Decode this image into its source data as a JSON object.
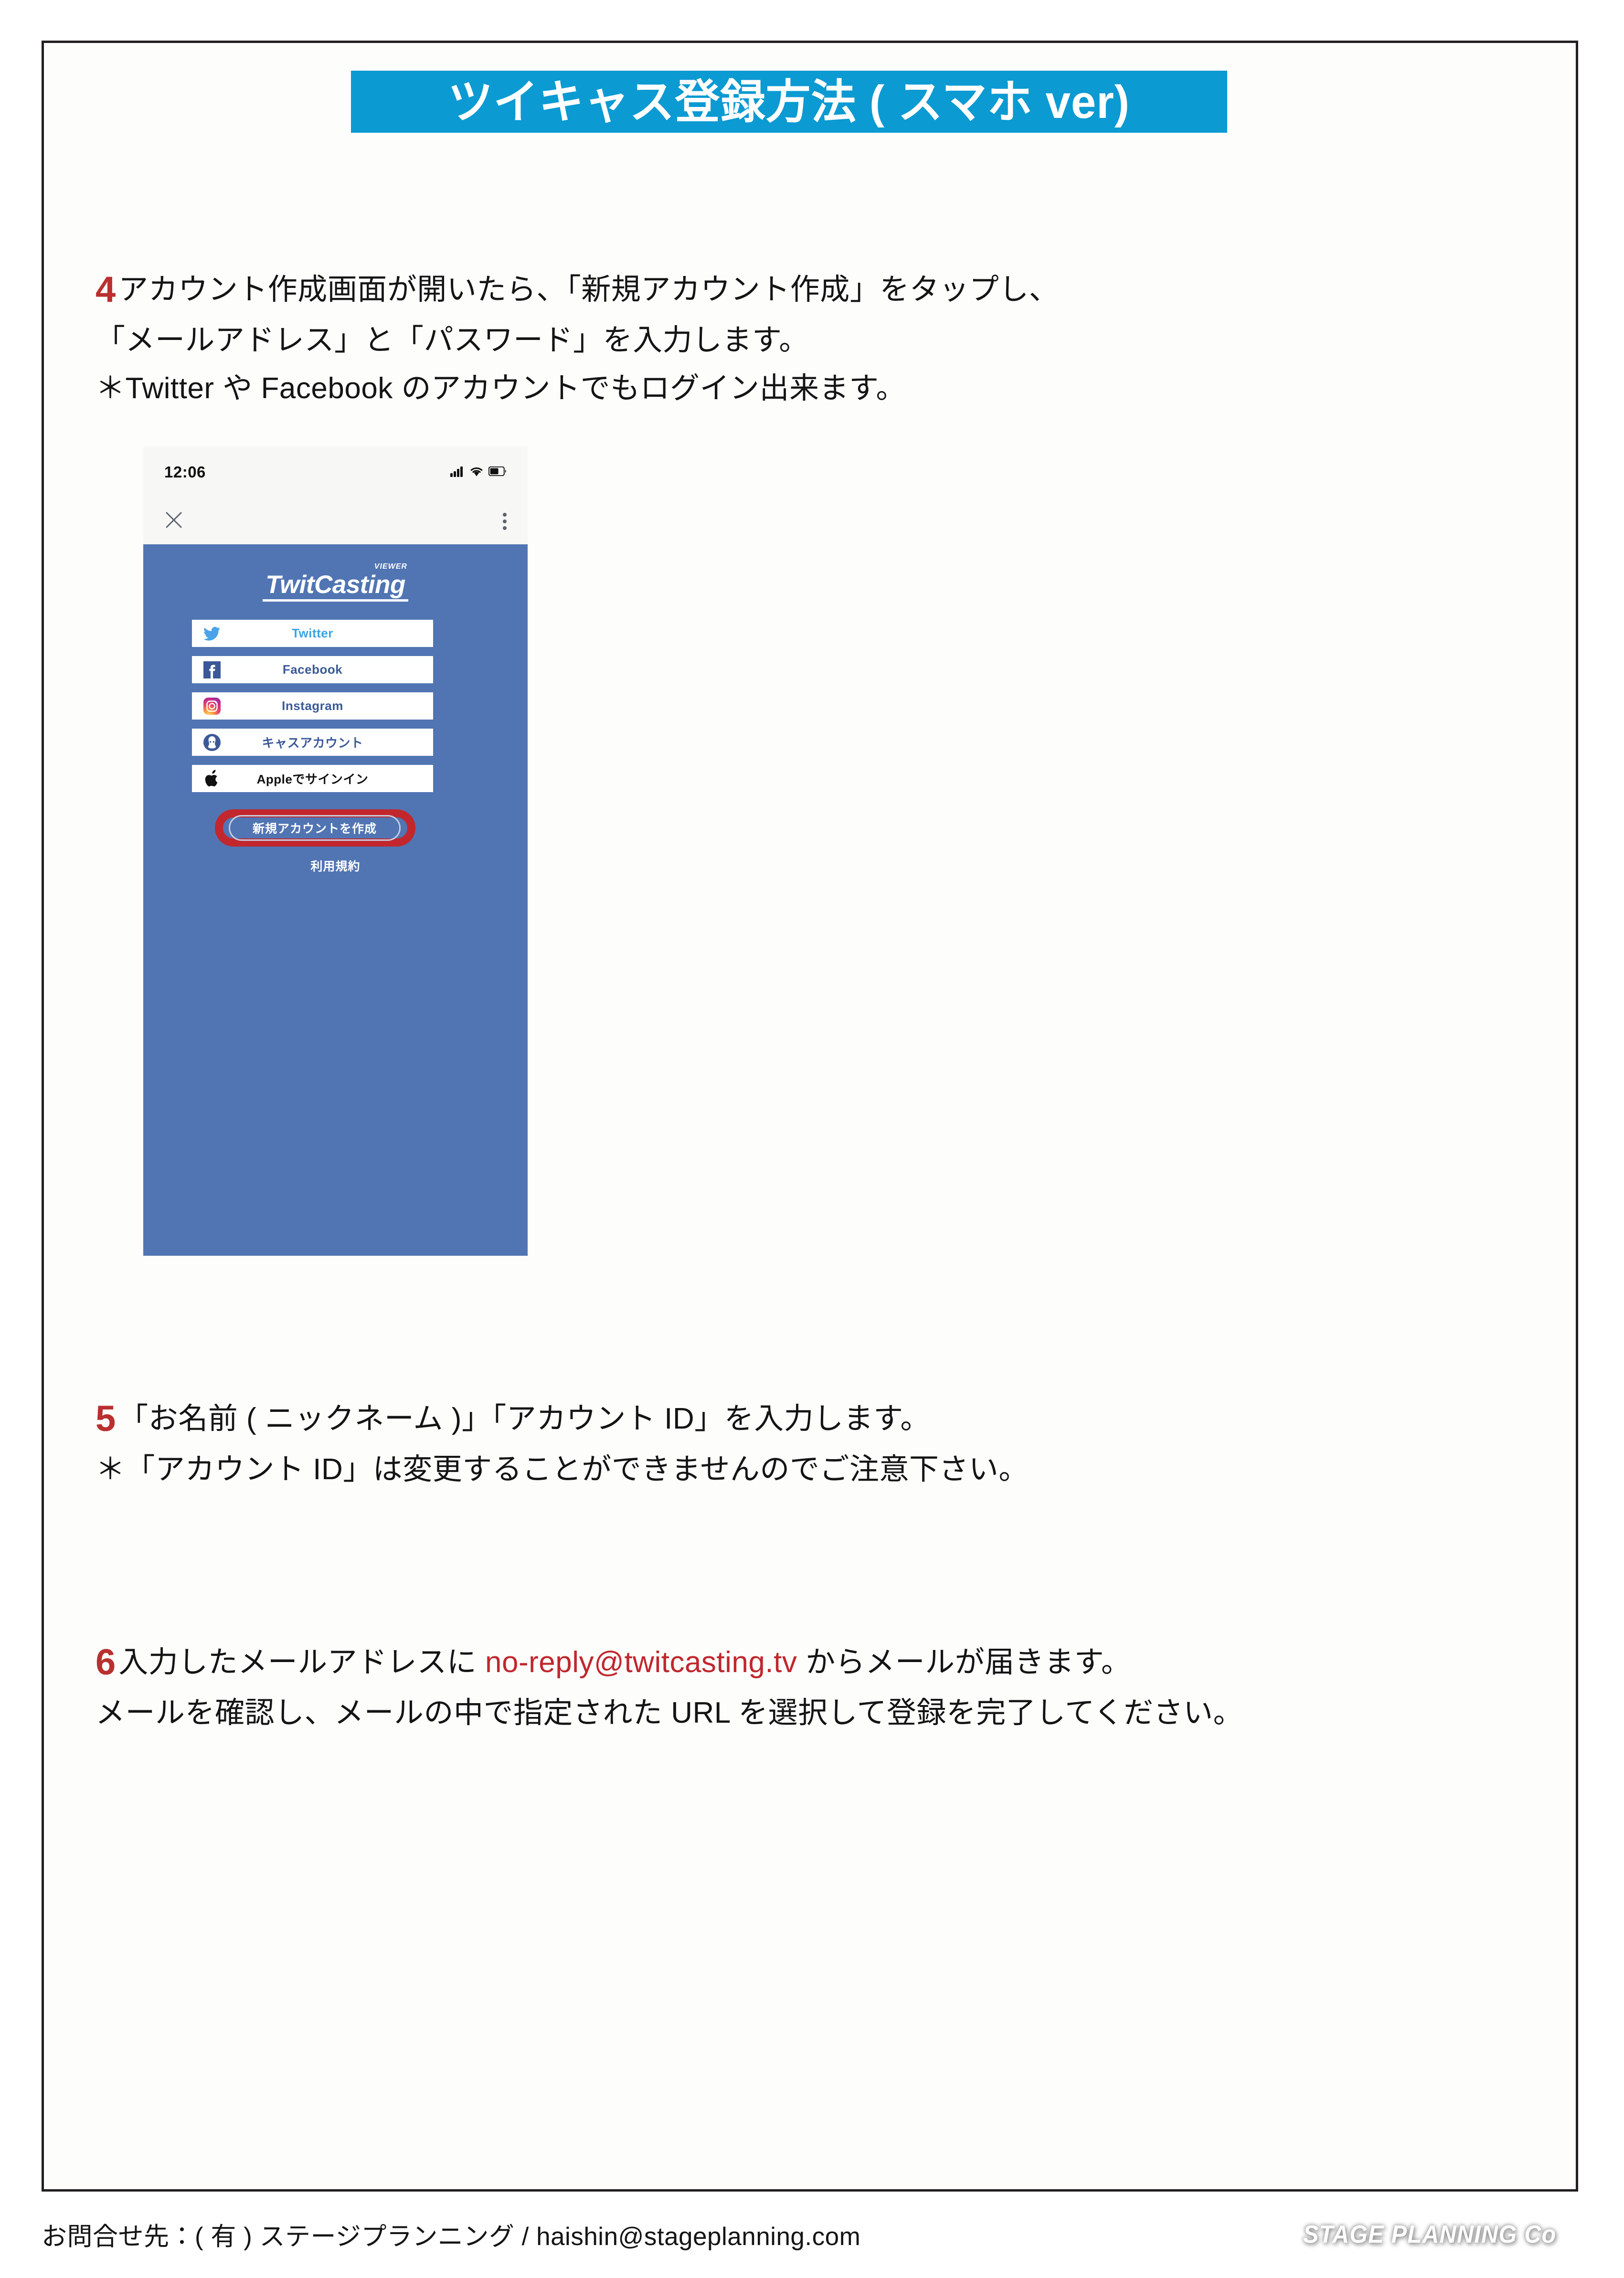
{
  "document": {
    "title": "ツイキャス登録方法 ( スマホ ver)",
    "banner_color": "#0c9ad2",
    "accent_red": "#b93030",
    "link_red": "#c0272d"
  },
  "steps": {
    "step4": {
      "number": "4",
      "line1": "アカウント作成画面が開いたら、「新規アカウント作成」をタップし、",
      "line2": "「メールアドレス」と「パスワード」を入力します。",
      "line3": "＊Twitter や Facebook のアカウントでもログイン出来ます。"
    },
    "step5": {
      "number": "5",
      "line1": "「お名前 ( ニックネーム )」「アカウント ID」を入力します。",
      "line2": "＊「アカウント ID」は変更することができませんのでご注意下さい。"
    },
    "step6": {
      "number": "6",
      "line1_before": "入力したメールアドレスに ",
      "line1_email": "no-reply@twitcasting.tv",
      "line1_after": " からメールが届きます。",
      "line2": "メールを確認し、メールの中で指定された URL を選択して登録を完了してください。"
    }
  },
  "phone": {
    "status": {
      "time": "12:06",
      "signal_icon": "cellular-signal-icon",
      "wifi_icon": "wifi-icon",
      "battery_icon": "battery-icon"
    },
    "navbar": {
      "close_icon": "close-icon",
      "menu_icon": "kebab-menu-icon"
    },
    "app": {
      "background_color": "#5175b3",
      "logo_main": "TwitCasting",
      "logo_superscript": "VIEWER",
      "login_buttons": [
        {
          "label": "Twitter",
          "icon": "twitter-bird-icon",
          "label_color": "#3aa3e3"
        },
        {
          "label": "Facebook",
          "icon": "facebook-icon",
          "label_color": "#3b5998"
        },
        {
          "label": "Instagram",
          "icon": "instagram-icon",
          "label_color": "#3b5998"
        },
        {
          "label": "キャスアカウント",
          "icon": "twitcasting-account-icon",
          "label_color": "#3b5998"
        },
        {
          "label": "Appleでサインイン",
          "icon": "apple-icon",
          "label_color": "#111111"
        }
      ],
      "create_account_label": "新規アカウントを作成",
      "terms_label": "利用規約",
      "highlight_color": "#c1272d"
    }
  },
  "footer": {
    "contact": "お問合せ先：( 有 ) ステージプランニング / haishin@stageplanning.com",
    "company_logo": "STAGE PLANNING Co"
  }
}
